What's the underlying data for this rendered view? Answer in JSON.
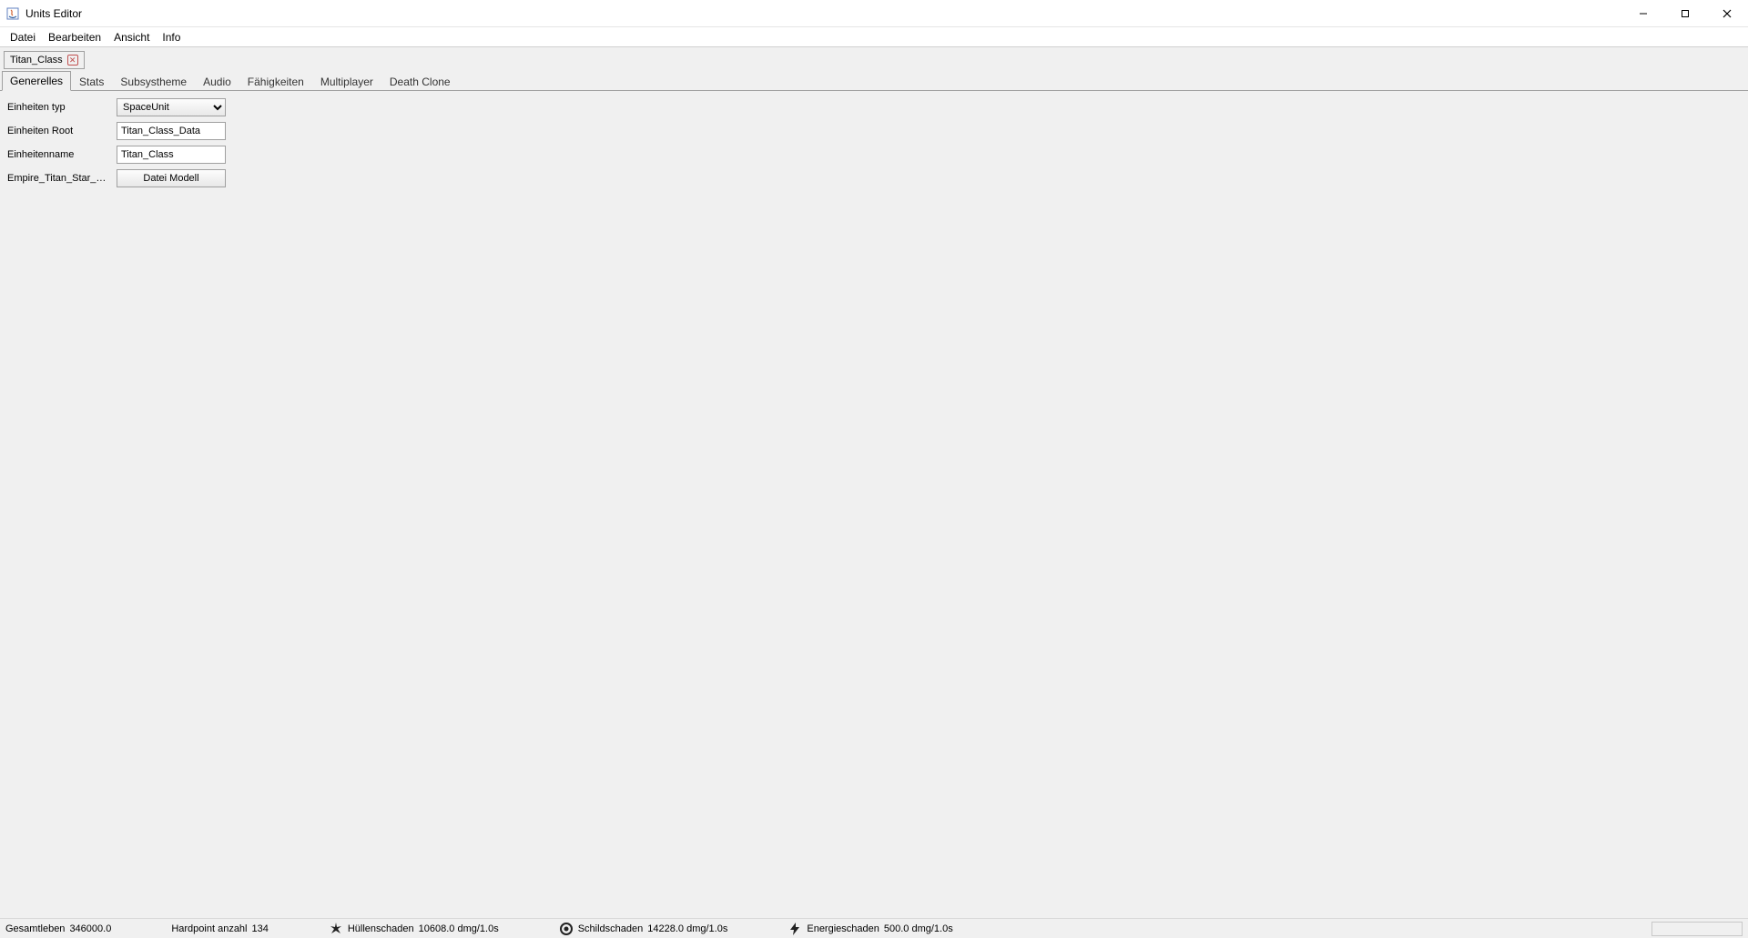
{
  "window": {
    "title": "Units Editor"
  },
  "menu": {
    "items": [
      "Datei",
      "Bearbeiten",
      "Ansicht",
      "Info"
    ]
  },
  "docTabs": [
    {
      "label": "Titan_Class"
    }
  ],
  "propTabs": {
    "items": [
      "Generelles",
      "Stats",
      "Subsystheme",
      "Audio",
      "Fähigkeiten",
      "Multiplayer",
      "Death Clone"
    ],
    "activeIndex": 0
  },
  "form": {
    "unitTypeLabel": "Einheiten typ",
    "unitTypeValue": "SpaceUnit",
    "unitRootLabel": "Einheiten Root",
    "unitRootValue": "Titan_Class_Data",
    "unitNameLabel": "Einheitenname",
    "unitNameValue": "Titan_Class",
    "modelRowLabel": "Empire_Titan_Star_Des...",
    "modelButtonLabel": "Datei Modell"
  },
  "status": {
    "totalLifeLabel": "Gesamtleben",
    "totalLifeValue": "346000.0",
    "hardpointLabel": "Hardpoint anzahl",
    "hardpointValue": "134",
    "hullDmgLabel": "Hüllenschaden",
    "hullDmgValue": "10608.0 dmg/1.0s",
    "shieldDmgLabel": "Schildschaden",
    "shieldDmgValue": "14228.0 dmg/1.0s",
    "energyDmgLabel": "Energieschaden",
    "energyDmgValue": "500.0 dmg/1.0s"
  }
}
